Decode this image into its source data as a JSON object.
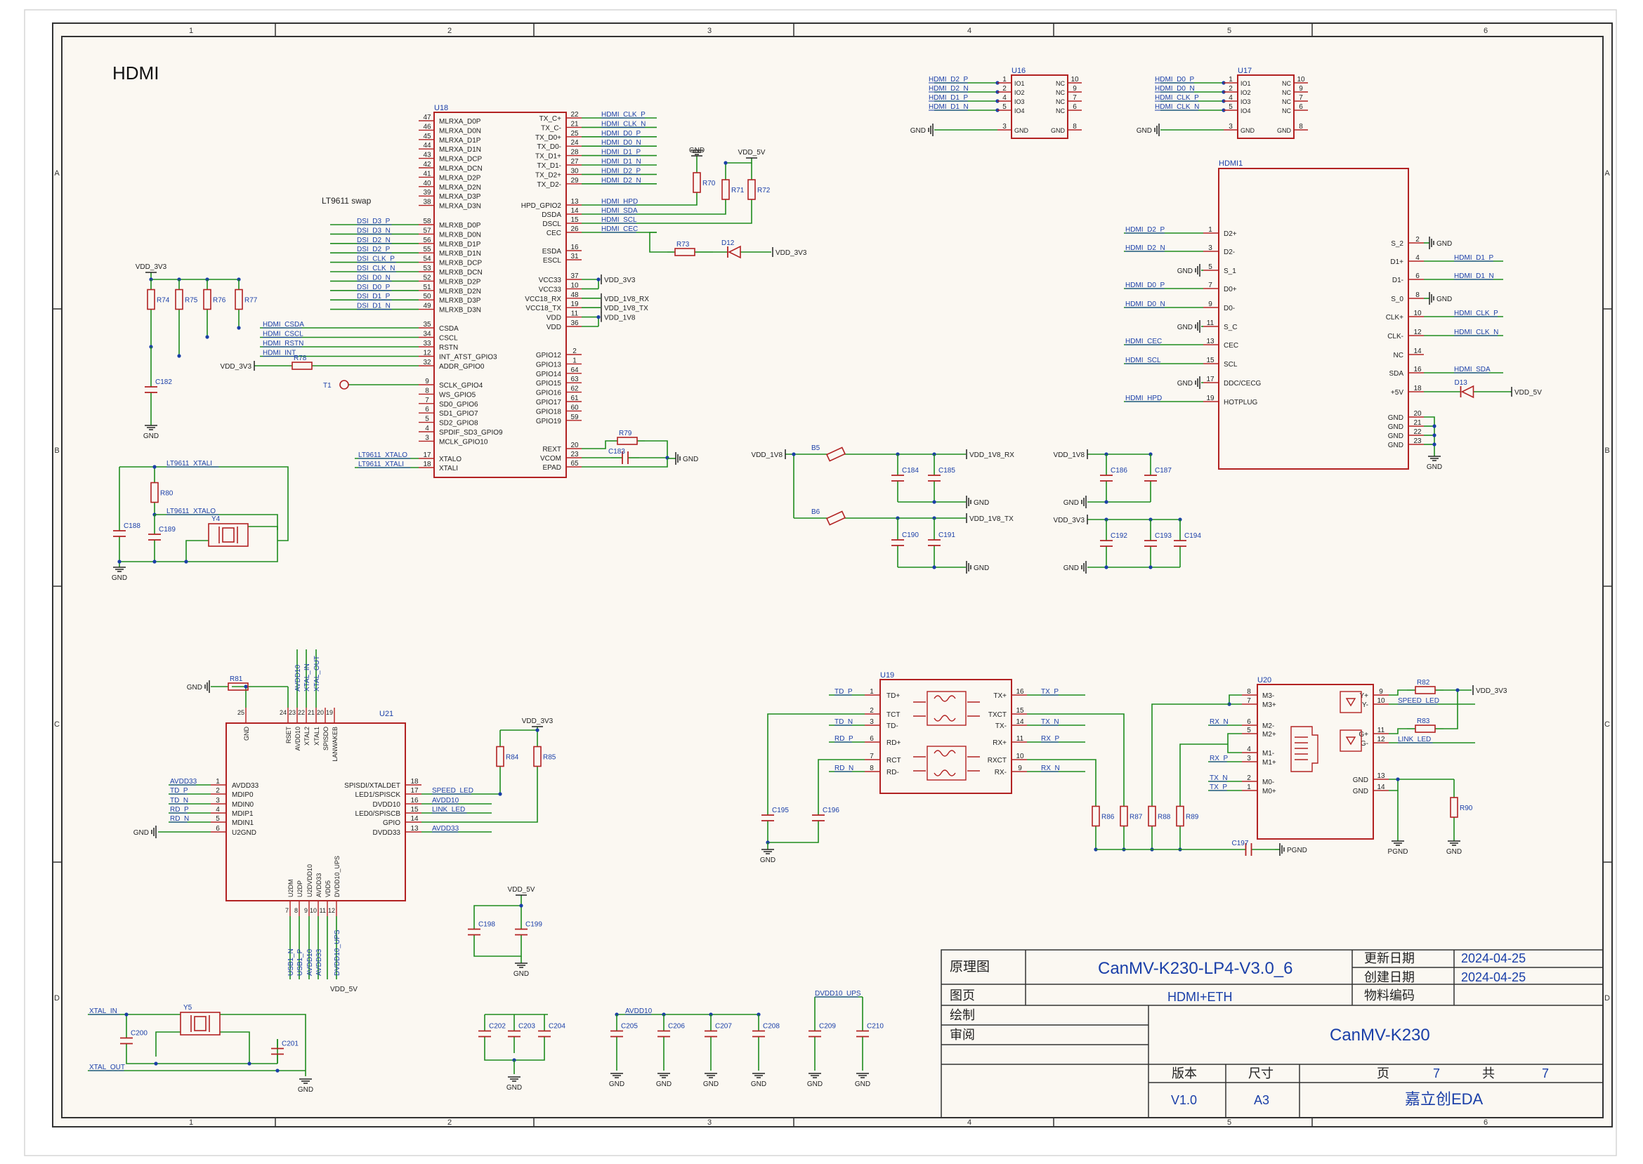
{
  "sheet": {
    "section_title": "HDMI",
    "col_numbers": [
      "1",
      "2",
      "3",
      "4",
      "5",
      "6"
    ],
    "row_letters": [
      "A",
      "B",
      "C",
      "D"
    ]
  },
  "u18": {
    "ref": "U18",
    "note": "LT9611 swap",
    "left_pins": [
      {
        "num": "47",
        "name": "MLRXA_D0P"
      },
      {
        "num": "46",
        "name": "MLRXA_D0N"
      },
      {
        "num": "45",
        "name": "MLRXA_D1P"
      },
      {
        "num": "44",
        "name": "MLRXA_D1N"
      },
      {
        "num": "43",
        "name": "MLRXA_DCP"
      },
      {
        "num": "42",
        "name": "MLRXA_DCN"
      },
      {
        "num": "41",
        "name": "MLRXA_D2P"
      },
      {
        "num": "40",
        "name": "MLRXA_D2N"
      },
      {
        "num": "39",
        "name": "MLRXA_D3P"
      },
      {
        "num": "38",
        "name": "MLRXA_D3N"
      },
      {
        "num": "58",
        "name": "MLRXB_D0P"
      },
      {
        "num": "57",
        "name": "MLRXB_D0N"
      },
      {
        "num": "56",
        "name": "MLRXB_D1P"
      },
      {
        "num": "55",
        "name": "MLRXB_D1N"
      },
      {
        "num": "54",
        "name": "MLRXB_DCP"
      },
      {
        "num": "53",
        "name": "MLRXB_DCN"
      },
      {
        "num": "52",
        "name": "MLRXB_D2P"
      },
      {
        "num": "51",
        "name": "MLRXB_D2N"
      },
      {
        "num": "50",
        "name": "MLRXB_D3P"
      },
      {
        "num": "49",
        "name": "MLRXB_D3N"
      },
      {
        "num": "35",
        "name": "CSDA"
      },
      {
        "num": "34",
        "name": "CSCL"
      },
      {
        "num": "33",
        "name": "RSTN"
      },
      {
        "num": "12",
        "name": "INT_ATST_GPIO3"
      },
      {
        "num": "32",
        "name": "ADDR_GPIO0"
      },
      {
        "num": "9",
        "name": "SCLK_GPIO4"
      },
      {
        "num": "8",
        "name": "WS_GPIO5"
      },
      {
        "num": "7",
        "name": "SD0_GPIO6"
      },
      {
        "num": "6",
        "name": "SD1_GPIO7"
      },
      {
        "num": "5",
        "name": "SD2_GPIO8"
      },
      {
        "num": "4",
        "name": "SPDIF_SD3_GPIO9"
      },
      {
        "num": "3",
        "name": "MCLK_GPIO10"
      },
      {
        "num": "17",
        "name": "XTALO"
      },
      {
        "num": "18",
        "name": "XTALI"
      }
    ],
    "right_pins": [
      {
        "num": "22",
        "name": "TX_C+"
      },
      {
        "num": "21",
        "name": "TX_C-"
      },
      {
        "num": "25",
        "name": "TX_D0+"
      },
      {
        "num": "24",
        "name": "TX_D0-"
      },
      {
        "num": "28",
        "name": "TX_D1+"
      },
      {
        "num": "27",
        "name": "TX_D1-"
      },
      {
        "num": "30",
        "name": "TX_D2+"
      },
      {
        "num": "29",
        "name": "TX_D2-"
      },
      {
        "num": "13",
        "name": "HPD_GPIO2"
      },
      {
        "num": "14",
        "name": "DSDA"
      },
      {
        "num": "15",
        "name": "DSCL"
      },
      {
        "num": "26",
        "name": "CEC"
      },
      {
        "num": "16",
        "name": "ESDA"
      },
      {
        "num": "31",
        "name": "ESCL"
      },
      {
        "num": "37",
        "name": "VCC33"
      },
      {
        "num": "10",
        "name": "VCC33"
      },
      {
        "num": "48",
        "name": "VCC18_RX"
      },
      {
        "num": "19",
        "name": "VCC18_TX"
      },
      {
        "num": "11",
        "name": "VDD"
      },
      {
        "num": "36",
        "name": "VDD"
      },
      {
        "num": "2",
        "name": "GPIO12"
      },
      {
        "num": "1",
        "name": "GPIO13"
      },
      {
        "num": "64",
        "name": "GPIO14"
      },
      {
        "num": "63",
        "name": "GPIO15"
      },
      {
        "num": "62",
        "name": "GPIO16"
      },
      {
        "num": "61",
        "name": "GPIO17"
      },
      {
        "num": "60",
        "name": "GPIO18"
      },
      {
        "num": "59",
        "name": "GPIO19"
      },
      {
        "num": "20",
        "name": "REXT"
      },
      {
        "num": "23",
        "name": "VCOM"
      },
      {
        "num": "65",
        "name": "EPAD"
      }
    ],
    "tx_nets": [
      "HDMI_CLK_P",
      "HDMI_CLK_N",
      "HDMI_D0_P",
      "HDMI_D0_N",
      "HDMI_D1_P",
      "HDMI_D1_N",
      "HDMI_D2_P",
      "HDMI_D2_N"
    ],
    "ctl_nets": [
      "HDMI_HPD",
      "HDMI_SDA",
      "HDMI_SCL",
      "HDMI_CEC"
    ],
    "dsi_nets": [
      "DSI_D3_P",
      "DSI_D3_N",
      "DSI_D2_N",
      "DSI_D2_P",
      "DSI_CLK_P",
      "DSI_CLK_N",
      "DSI_D0_N",
      "DSI_D0_P",
      "DSI_D1_P",
      "DSI_D1_N"
    ],
    "host_nets": [
      "HDMI_CSDA",
      "HDMI_CSCL",
      "HDMI_RSTN",
      "HDMI_INT"
    ],
    "pwr_labels": [
      "VDD_3V3",
      "VDD_1V8_RX",
      "VDD_1V8_TX",
      "VDD_1V8"
    ],
    "xtal_nets": [
      "LT9611_XTALO",
      "LT9611_XTALI"
    ]
  },
  "passives_top": {
    "gnd": "GND",
    "vdd5": "VDD_5V",
    "vdd33": "VDD_3V3",
    "r_left": [
      "R74",
      "R75",
      "R76",
      "R77"
    ],
    "r78": "R78",
    "c182": "C182",
    "t1": "T1",
    "r_top": [
      "R70",
      "R71",
      "R72"
    ],
    "r73": "R73",
    "d12": "D12",
    "r79": "R79",
    "c183": "C183",
    "xtal_left": {
      "r80": "R80",
      "c188": "C188",
      "c189": "C189",
      "y4": "Y4",
      "net_i": "LT9611_XTALI",
      "net_o": "LT9611_XTALO"
    }
  },
  "esd": {
    "u16": {
      "ref": "U16",
      "nets": [
        "HDMI_D2_P",
        "HDMI_D2_N",
        "HDMI_D1_P",
        "HDMI_D1_N"
      ]
    },
    "u17": {
      "ref": "U17",
      "nets": [
        "HDMI_D0_P",
        "HDMI_D0_N",
        "HDMI_CLK_P",
        "HDMI_CLK_N"
      ]
    },
    "left_pins": [
      "IO1",
      "IO2",
      "IO3",
      "IO4",
      "GND"
    ],
    "right_pins": [
      "NC",
      "NC",
      "NC",
      "NC",
      "GND"
    ],
    "left_nums": [
      "1",
      "2",
      "4",
      "5",
      "3"
    ],
    "right_nums": [
      "10",
      "9",
      "7",
      "6",
      "8"
    ]
  },
  "hdmi1": {
    "ref": "HDMI1",
    "left_pins": [
      {
        "num": "1",
        "name": "D2+",
        "net": "HDMI_D2_P"
      },
      {
        "num": "3",
        "name": "D2-",
        "net": "HDMI_D2_N"
      },
      {
        "num": "5",
        "name": "S_1",
        "net": "GND"
      },
      {
        "num": "7",
        "name": "D0+",
        "net": "HDMI_D0_P"
      },
      {
        "num": "9",
        "name": "D0-",
        "net": "HDMI_D0_N"
      },
      {
        "num": "11",
        "name": "S_C",
        "net": "GND"
      },
      {
        "num": "13",
        "name": "CEC",
        "net": "HDMI_CEC"
      },
      {
        "num": "15",
        "name": "SCL",
        "net": "HDMI_SCL"
      },
      {
        "num": "17",
        "name": "DDC/CECG",
        "net": "GND"
      },
      {
        "num": "19",
        "name": "HOTPLUG",
        "net": "HDMI_HPD"
      }
    ],
    "right_pins": [
      {
        "num": "2",
        "name": "S_2",
        "net": "GND"
      },
      {
        "num": "4",
        "name": "D1+",
        "net": "HDMI_D1_P"
      },
      {
        "num": "6",
        "name": "D1-",
        "net": "HDMI_D1_N"
      },
      {
        "num": "8",
        "name": "S_0",
        "net": "GND"
      },
      {
        "num": "10",
        "name": "CLK+",
        "net": "HDMI_CLK_P"
      },
      {
        "num": "12",
        "name": "CLK-",
        "net": "HDMI_CLK_N"
      },
      {
        "num": "14",
        "name": "NC",
        "net": ""
      },
      {
        "num": "16",
        "name": "SDA",
        "net": "HDMI_SDA"
      },
      {
        "num": "18",
        "name": "+5V",
        "net": ""
      },
      {
        "num": "20",
        "name": "GND",
        "net": ""
      },
      {
        "num": "21",
        "name": "GND",
        "net": ""
      },
      {
        "num": "22",
        "name": "GND",
        "net": ""
      },
      {
        "num": "23",
        "name": "GND",
        "net": ""
      }
    ],
    "d13": "D13",
    "vdd5": "VDD_5V",
    "gnd": "GND"
  },
  "filters": {
    "vdd18": "VDD_1V8",
    "b5": "B5",
    "b6": "B6",
    "rx": "VDD_1V8_RX",
    "tx": "VDD_1V8_TX",
    "caps_rx": [
      "C184",
      "C185"
    ],
    "caps_tx": [
      "C190",
      "C191"
    ],
    "caps_18": [
      "C186",
      "C187"
    ],
    "caps_33": [
      "C192",
      "C193",
      "C194"
    ],
    "vdd33": "VDD_3V3",
    "gnd": "GND"
  },
  "u21": {
    "ref": "U21",
    "top_pins": [
      {
        "num": "25",
        "name": "GND"
      },
      {
        "num": "24",
        "name": "RSET"
      },
      {
        "num": "23",
        "name": "AVDD10"
      },
      {
        "num": "22",
        "name": "XTAL2"
      },
      {
        "num": "21",
        "name": "XTAL1"
      },
      {
        "num": "20",
        "name": "SPISDO"
      },
      {
        "num": "19",
        "name": "LANWAKEB"
      }
    ],
    "top_nets": [
      "AVDD10",
      "XTAL_IN",
      "XTAL_OUT"
    ],
    "left_pins": [
      {
        "num": "1",
        "name": "AVDD33",
        "net": "AVDD33"
      },
      {
        "num": "2",
        "name": "MDIP0",
        "net": "TD_P"
      },
      {
        "num": "3",
        "name": "MDIN0",
        "net": "TD_N"
      },
      {
        "num": "4",
        "name": "MDIP1",
        "net": "RD_P"
      },
      {
        "num": "5",
        "name": "MDIN1",
        "net": "RD_N"
      },
      {
        "num": "6",
        "name": "U2GND",
        "net": "GND"
      }
    ],
    "right_pins": [
      {
        "num": "18",
        "name": "SPISDI/XTALDET",
        "net": ""
      },
      {
        "num": "17",
        "name": "LED1/SPISCK",
        "net": "SPEED_LED"
      },
      {
        "num": "16",
        "name": "DVDD10",
        "net": "AVDD10"
      },
      {
        "num": "15",
        "name": "LED0/SPISCB",
        "net": "LINK_LED"
      },
      {
        "num": "14",
        "name": "GPIO",
        "net": ""
      },
      {
        "num": "13",
        "name": "DVDD33",
        "net": "AVDD33"
      }
    ],
    "bottom_pins": [
      {
        "num": "7",
        "name": "U2DM"
      },
      {
        "num": "8",
        "name": "U2DP"
      },
      {
        "num": "9",
        "name": "U2DVDD10"
      },
      {
        "num": "10",
        "name": "AVDD33"
      },
      {
        "num": "11",
        "name": "VDD5"
      },
      {
        "num": "12",
        "name": "DVDD10_UPS"
      }
    ],
    "bottom_nets": [
      "USB1_N",
      "USB1_P",
      "AVDD10",
      "AVDD33",
      "DVDD10_UPS"
    ],
    "vdd5": "VDD_5V",
    "vdd33": "VDD_3V3",
    "r81": "R81",
    "r84": "R84",
    "r85": "R85",
    "gnd": "GND"
  },
  "u19": {
    "ref": "U19",
    "left_pins": [
      {
        "num": "1",
        "name": "TD+",
        "net": "TD_P"
      },
      {
        "num": "2",
        "name": "TCT",
        "net": ""
      },
      {
        "num": "3",
        "name": "TD-",
        "net": "TD_N"
      },
      {
        "num": "6",
        "name": "RD+",
        "net": "RD_P"
      },
      {
        "num": "7",
        "name": "RCT",
        "net": ""
      },
      {
        "num": "8",
        "name": "RD-",
        "net": "RD_N"
      }
    ],
    "right_pins": [
      {
        "num": "16",
        "name": "TX+",
        "net": "TX_P"
      },
      {
        "num": "15",
        "name": "TXCT",
        "net": ""
      },
      {
        "num": "14",
        "name": "TX-",
        "net": "TX_N"
      },
      {
        "num": "11",
        "name": "RX+",
        "net": "RX_P"
      },
      {
        "num": "10",
        "name": "RXCT",
        "net": ""
      },
      {
        "num": "9",
        "name": "RX-",
        "net": "RX_N"
      }
    ],
    "caps": [
      "C195",
      "C196"
    ],
    "gnd": "GND"
  },
  "u20": {
    "ref": "U20",
    "left_pins": [
      {
        "num": "8",
        "name": "M3-"
      },
      {
        "num": "7",
        "name": "M3+"
      },
      {
        "num": "6",
        "name": "M2-"
      },
      {
        "num": "5",
        "name": "M2+"
      },
      {
        "num": "4",
        "name": "M1-"
      },
      {
        "num": "3",
        "name": "M1+"
      },
      {
        "num": "2",
        "name": "M0-"
      },
      {
        "num": "1",
        "name": "M0+"
      }
    ],
    "left_nets": [
      "RX_N",
      "RX_P",
      "TX_N",
      "TX_P"
    ],
    "right_pins": [
      {
        "num": "9",
        "name": "Y+"
      },
      {
        "num": "10",
        "name": "Y-"
      },
      {
        "num": "11",
        "name": "G+"
      },
      {
        "num": "12",
        "name": "G-"
      },
      {
        "num": "13",
        "name": "GND"
      },
      {
        "num": "14",
        "name": "GND"
      }
    ],
    "r82": "R82",
    "r83": "R83",
    "r90": "R90",
    "speed": "SPEED_LED",
    "link": "LINK_LED",
    "vdd33": "VDD_3V3",
    "pgnd": "PGND",
    "gnd": "GND",
    "r_term": [
      "R86",
      "R87",
      "R88",
      "R89"
    ],
    "c197": "C197"
  },
  "bottom_caps": {
    "vdd5": "VDD_5V",
    "c198": "C198",
    "c199": "C199",
    "gnd": "GND",
    "y5": "Y5",
    "c200": "C200",
    "c201": "C201",
    "xtal_in": "XTAL_IN",
    "xtal_out": "XTAL_OUT",
    "g1": [
      "C202",
      "C203",
      "C204"
    ],
    "avdd10": "AVDD10",
    "g2": [
      "C205",
      "C206",
      "C207",
      "C208"
    ],
    "dvdd": "DVDD10_UPS",
    "g3": [
      "C209",
      "C210"
    ]
  },
  "title_block": {
    "lbl_schematic": "原理图",
    "project": "CanMV-K230-LP4-V3.0_6",
    "lbl_update": "更新日期",
    "update_date": "2024-04-25",
    "lbl_create": "创建日期",
    "create_date": "2024-04-25",
    "lbl_page": "图页",
    "page_name": "HDMI+ETH",
    "lbl_material": "物料编码",
    "lbl_drawn": "绘制",
    "lbl_review": "审阅",
    "board": "CanMV-K230",
    "lbl_version": "版本",
    "lbl_size": "尺寸",
    "lbl_pg": "页",
    "page_no": "7",
    "lbl_total": "共",
    "total": "7",
    "version": "V1.0",
    "size": "A3",
    "company": "嘉立创EDA"
  }
}
